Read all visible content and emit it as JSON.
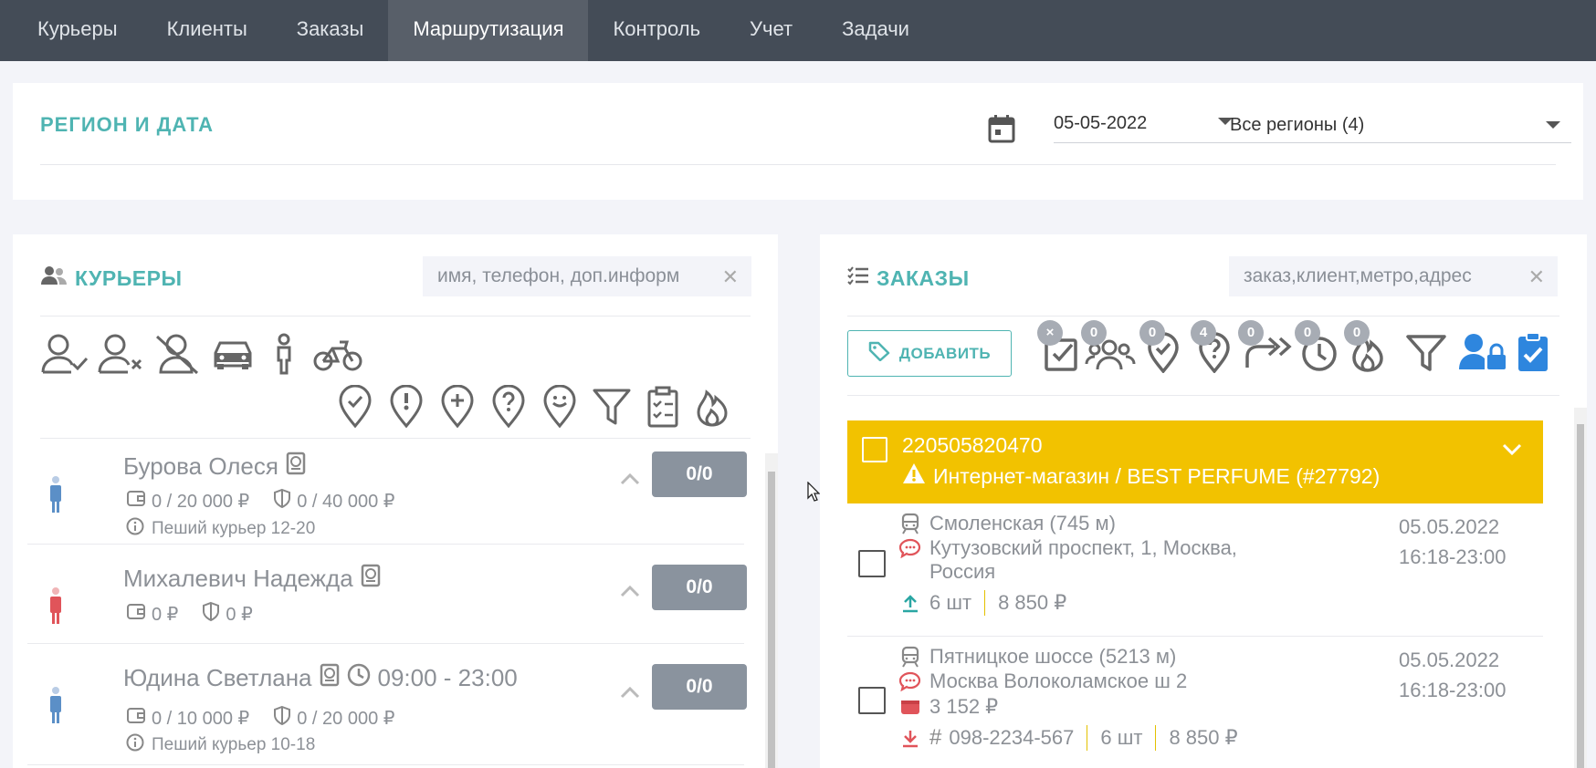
{
  "nav": {
    "tabs": [
      {
        "label": "Курьеры"
      },
      {
        "label": "Клиенты"
      },
      {
        "label": "Заказы"
      },
      {
        "label": "Маршрутизация"
      },
      {
        "label": "Контроль"
      },
      {
        "label": "Учет"
      },
      {
        "label": "Задачи"
      }
    ],
    "active_index": 3
  },
  "region": {
    "title": "РЕГИОН И ДАТА",
    "date_value": "05-05-2022",
    "region_value": "Все регионы (4)"
  },
  "couriers": {
    "title": "КУРЬЕРЫ",
    "search_placeholder": "имя, телефон, доп.информ",
    "filter_icons_row1": [
      "user-check-icon",
      "user-x-icon",
      "user-off-icon",
      "car-icon",
      "walker-icon",
      "bike-icon"
    ],
    "filter_icons_row2": [
      "pin-check-icon",
      "pin-alert-icon",
      "pin-plus-icon",
      "pin-question-icon",
      "pin-smile-icon",
      "filter-icon",
      "clipboard-list-icon",
      "flame-icon"
    ],
    "list": [
      {
        "name": "Бурова Олеся",
        "gender": "female",
        "avatar_color": "#5b8fc7",
        "wallet": "0 / 20 000 ₽",
        "deposit": "0 / 40 000 ₽",
        "schedule": "",
        "note": "Пеший курьер 12-20",
        "count": "0/0"
      },
      {
        "name": "Михалевич Надежда",
        "gender": "female",
        "avatar_color": "#e0545a",
        "wallet": "0 ₽",
        "deposit": "0 ₽",
        "schedule": "",
        "note": "",
        "count": "0/0"
      },
      {
        "name": "Юдина Светлана",
        "gender": "female",
        "avatar_color": "#5b8fc7",
        "wallet": "0 / 10 000 ₽",
        "deposit": "0 / 20 000 ₽",
        "schedule": "09:00 - 23:00",
        "note": "Пеший курьер 10-18",
        "count": "0/0"
      }
    ]
  },
  "orders": {
    "title": "ЗАКАЗЫ",
    "search_placeholder": "заказ,клиент,метро,адрес",
    "add_label": "ДОБАВИТЬ",
    "filter_badges": [
      "×",
      "0",
      "0",
      "4",
      "0",
      "0",
      "0"
    ],
    "group": {
      "number": "220505820470",
      "shop": "Интернет-магазин / BEST PERFUME (#27792)",
      "color": "#f2c200"
    },
    "items": [
      {
        "metro": "Смоленская (745 м)",
        "address_line1": "Кутузовский проспект, 1, Москва,",
        "address_line2": "Россия",
        "date": "05.05.2022",
        "time": "16:18-23:00",
        "qty": "6 шт",
        "sum": "8 850 ₽"
      },
      {
        "metro": "Пятницкое шоссе (5213 м)",
        "address_line1": "Москва Волоколамское ш 2",
        "payment": "3 152 ₽",
        "date": "05.05.2022",
        "time": "16:18-23:00",
        "tracking": "098-2234-567",
        "qty": "6 шт",
        "sum": "8 850 ₽"
      }
    ]
  },
  "colors": {
    "nav_bg": "#444c57",
    "accent": "#4fb4b2",
    "group_yellow": "#f2c200",
    "count_badge": "#8a939e",
    "action_blue": "#2e86de"
  }
}
